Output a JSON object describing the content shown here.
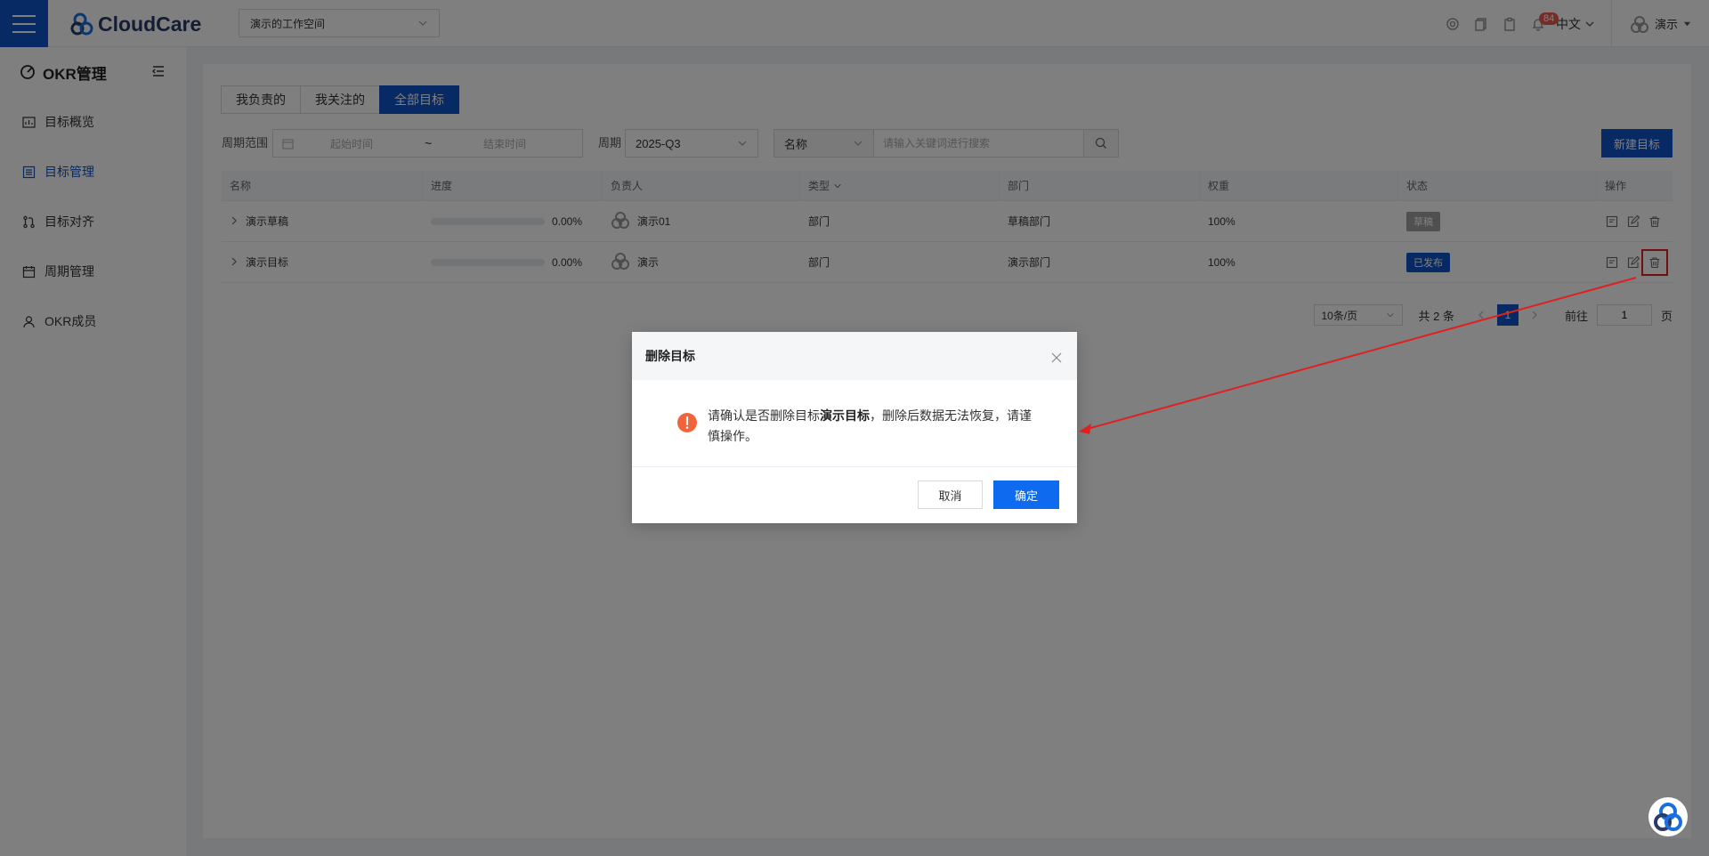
{
  "header": {
    "logo_text": "CloudCare",
    "workspace": "演示的工作空间",
    "notifications_count": "84",
    "language": "中文",
    "user_name": "演示"
  },
  "sidebar": {
    "title": "OKR管理",
    "items": [
      {
        "label": "目标概览",
        "icon": "dashboard-icon",
        "active": false
      },
      {
        "label": "目标管理",
        "icon": "list-icon",
        "active": true
      },
      {
        "label": "目标对齐",
        "icon": "align-icon",
        "active": false
      },
      {
        "label": "周期管理",
        "icon": "calendar-icon",
        "active": false
      },
      {
        "label": "OKR成员",
        "icon": "user-icon",
        "active": false
      }
    ]
  },
  "tabs": [
    {
      "label": "我负责的",
      "active": false
    },
    {
      "label": "我关注的",
      "active": false
    },
    {
      "label": "全部目标",
      "active": true
    }
  ],
  "filters": {
    "period_range_label": "周期范围",
    "start_placeholder": "起始时间",
    "range_separator": "~",
    "end_placeholder": "结束时间",
    "period_label": "周期",
    "period_value": "2025-Q3",
    "field_select": "名称",
    "search_placeholder": "请输入关键词进行搜索",
    "new_button": "新建目标"
  },
  "table": {
    "columns": [
      "名称",
      "进度",
      "负责人",
      "类型",
      "部门",
      "权重",
      "状态",
      "操作"
    ],
    "rows": [
      {
        "name": "演示草稿",
        "progress": 0,
        "progress_text": "0.00%",
        "owner": "演示01",
        "type": "部门",
        "department": "草稿部门",
        "weight": "100%",
        "status": "草稿",
        "status_kind": "draft"
      },
      {
        "name": "演示目标",
        "progress": 0,
        "progress_text": "0.00%",
        "owner": "演示",
        "type": "部门",
        "department": "演示部门",
        "weight": "100%",
        "status": "已发布",
        "status_kind": "published"
      }
    ]
  },
  "pagination": {
    "page_size": "10条/页",
    "total": "共 2 条",
    "current_page": "1",
    "goto_label": "前往",
    "goto_value": "1",
    "page_suffix": "页"
  },
  "dialog": {
    "title": "删除目标",
    "message_prefix": "请确认是否删除目标",
    "message_target": "演示目标",
    "message_suffix": "，删除后数据无法恢复，请谨慎操作。",
    "cancel_label": "取消",
    "confirm_label": "确定"
  },
  "colors": {
    "primary": "#0e54c9",
    "confirm": "#0e6bf0",
    "warning": "#f0643c",
    "annotation": "#e02020"
  }
}
